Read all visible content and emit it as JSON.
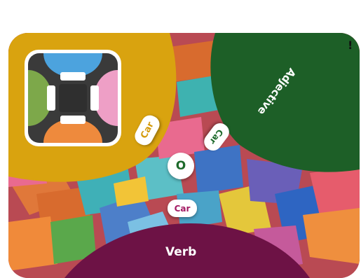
{
  "board": {
    "zones": [
      {
        "id": "yellow",
        "color": "#d9a30f"
      },
      {
        "id": "green",
        "color": "#1d5f27",
        "label": "Adjective"
      },
      {
        "id": "maroon",
        "color": "#6d1245",
        "label": "Verb"
      }
    ],
    "edge_mark": "!"
  },
  "logo": {
    "icon": "grid-logo-icon",
    "colors": {
      "top": "#4ca3de",
      "left": "#7da84a",
      "right": "#ee9fc6",
      "bottom": "#ee8a3d",
      "center": "#3a3a3a",
      "frame": "#ffffff"
    }
  },
  "tokens": [
    {
      "id": "car-yellow",
      "label": "Car",
      "color": "#d49b0d"
    },
    {
      "id": "car-green",
      "label": "Car",
      "color": "#1d6a2b"
    },
    {
      "id": "o-green",
      "label": "O",
      "color": "#1d6a2b"
    },
    {
      "id": "car-magenta",
      "label": "Car",
      "color": "#a31a63"
    }
  ]
}
